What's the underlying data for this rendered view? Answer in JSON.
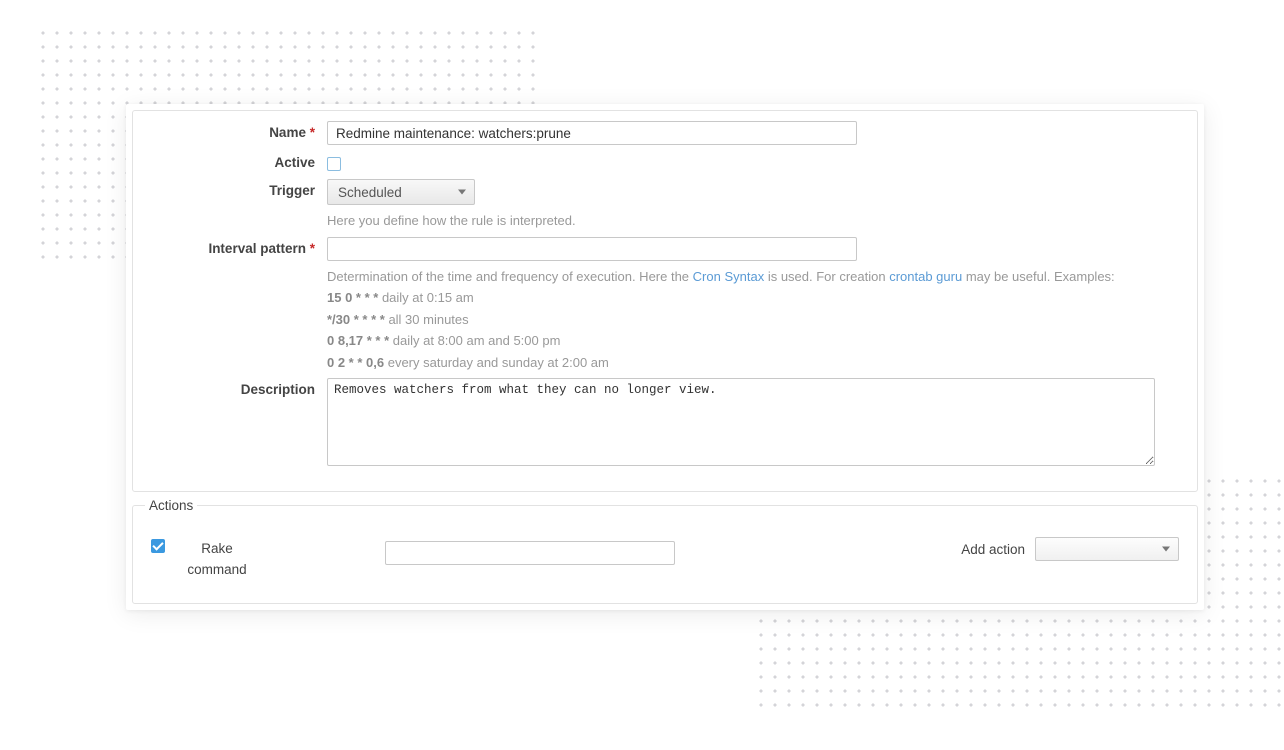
{
  "form": {
    "name_label": "Name",
    "name_value": "Redmine maintenance: watchers:prune",
    "active_label": "Active",
    "active_checked": false,
    "trigger_label": "Trigger",
    "trigger_value": "Scheduled",
    "trigger_help": "Here you define how the rule is interpreted.",
    "interval_label": "Interval pattern",
    "interval_value": "",
    "interval_help_prefix": "Determination of the time and frequency of execution. Here the ",
    "interval_help_link1": "Cron Syntax",
    "interval_help_mid": " is used. For creation ",
    "interval_help_link2": "crontab guru",
    "interval_help_suffix": " may be useful. Examples:",
    "examples": [
      {
        "code": "15 0 * * *",
        "desc": " daily at 0:15 am"
      },
      {
        "code": "*/30 * * * *",
        "desc": " all 30 minutes"
      },
      {
        "code": "0 8,17 * * *",
        "desc": " daily at 8:00 am and 5:00 pm"
      },
      {
        "code": "0 2 * * 0,6",
        "desc": " every saturday and sunday at 2:00 am"
      }
    ],
    "description_label": "Description",
    "description_value": "Removes watchers from what they can no longer view."
  },
  "actions": {
    "legend": "Actions",
    "rake_checked": true,
    "rake_label": "Rake command",
    "rake_value": "",
    "add_action_label": "Add action",
    "add_action_value": ""
  }
}
